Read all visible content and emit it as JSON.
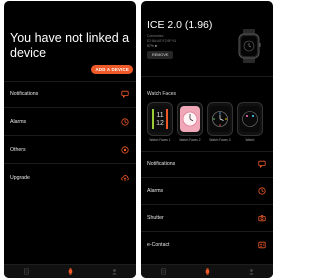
{
  "left_screen": {
    "title": "You have not linked a device",
    "add_button": "ADD A DEVICE",
    "menu": [
      {
        "label": "Notifications",
        "icon": "message-icon"
      },
      {
        "label": "Alarms",
        "icon": "clock-icon"
      },
      {
        "label": "Others",
        "icon": "target-icon"
      },
      {
        "label": "Upgrade",
        "icon": "cloud-upload-icon"
      }
    ]
  },
  "right_screen": {
    "device_name": "ICE 2.0 (1.96)",
    "status_lines": [
      "Connected",
      "E2:8A:AE:F2:9F:91",
      "57% ■"
    ],
    "remove_button": "REMOVE",
    "watch_faces_label": "Watch Faces",
    "watch_faces": [
      "Watch Faces 1",
      "Watch Faces 2",
      "Watch Faces 3",
      "Watch"
    ],
    "menu": [
      {
        "label": "Notifications",
        "icon": "message-icon"
      },
      {
        "label": "Alarms",
        "icon": "clock-icon"
      },
      {
        "label": "Shutter",
        "icon": "camera-icon"
      },
      {
        "label": "e-Contact",
        "icon": "contact-card-icon"
      }
    ]
  },
  "tabbar": {
    "items": [
      {
        "icon": "document-icon",
        "active": false
      },
      {
        "icon": "watch-icon",
        "active": true
      },
      {
        "icon": "profile-icon",
        "active": false
      }
    ]
  },
  "colors": {
    "accent": "#f05a28",
    "background": "#000000",
    "tab_inactive": "#444444"
  }
}
